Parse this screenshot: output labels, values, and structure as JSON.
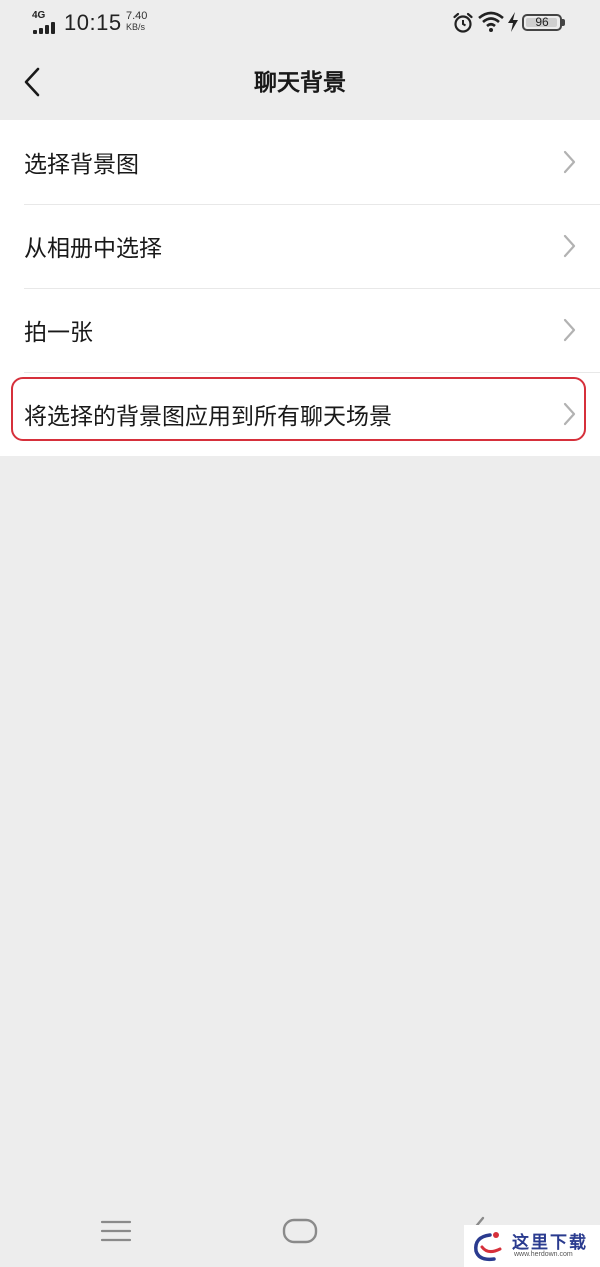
{
  "status_bar": {
    "network_type": "4G",
    "time": "10:15",
    "net_speed_value": "7.40",
    "net_speed_unit": "KB/s",
    "battery_level": 96,
    "battery_text": "96",
    "icons": [
      "signal-icon",
      "alarm-icon",
      "wifi-icon",
      "charge-icon",
      "battery-icon"
    ]
  },
  "nav_bar": {
    "back_icon": "chevron-left-icon",
    "title": "聊天背景"
  },
  "menu": {
    "items": [
      {
        "label": "选择背景图",
        "icon": "chevron-right-icon"
      },
      {
        "label": "从相册中选择",
        "icon": "chevron-right-icon"
      },
      {
        "label": "拍一张",
        "icon": "chevron-right-icon"
      },
      {
        "label": "将选择的背景图应用到所有聊天场景",
        "icon": "chevron-right-icon",
        "highlighted": true
      }
    ]
  },
  "highlight_color": "#d6303b",
  "bottom_nav": {
    "icons": [
      "menu-nav-icon",
      "home-nav-icon",
      "back-nav-icon"
    ]
  },
  "watermark": {
    "text": "这里下载",
    "url": "www.herdown.com"
  }
}
